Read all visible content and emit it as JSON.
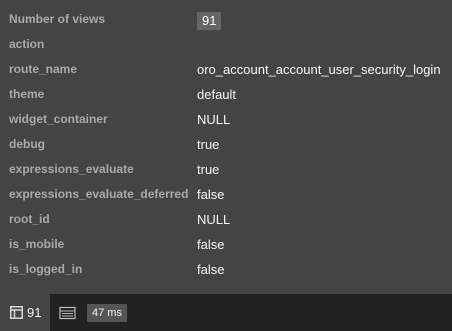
{
  "panel": {
    "rows": [
      {
        "key": "Number of views",
        "value": "91",
        "badge": true
      },
      {
        "key": "action",
        "value": ""
      },
      {
        "key": "route_name",
        "value": "oro_account_account_user_security_login"
      },
      {
        "key": "theme",
        "value": "default"
      },
      {
        "key": "widget_container",
        "value": "NULL"
      },
      {
        "key": "debug",
        "value": "true"
      },
      {
        "key": "expressions_evaluate",
        "value": "true"
      },
      {
        "key": "expressions_evaluate_deferred",
        "value": "false"
      },
      {
        "key": "root_id",
        "value": "NULL"
      },
      {
        "key": "is_mobile",
        "value": "false"
      },
      {
        "key": "is_logged_in",
        "value": "false"
      }
    ]
  },
  "toolbar": {
    "views_icon": "layout-icon",
    "views_count": "91",
    "time_icon": "timer-icon",
    "time_value": "47 ms"
  }
}
